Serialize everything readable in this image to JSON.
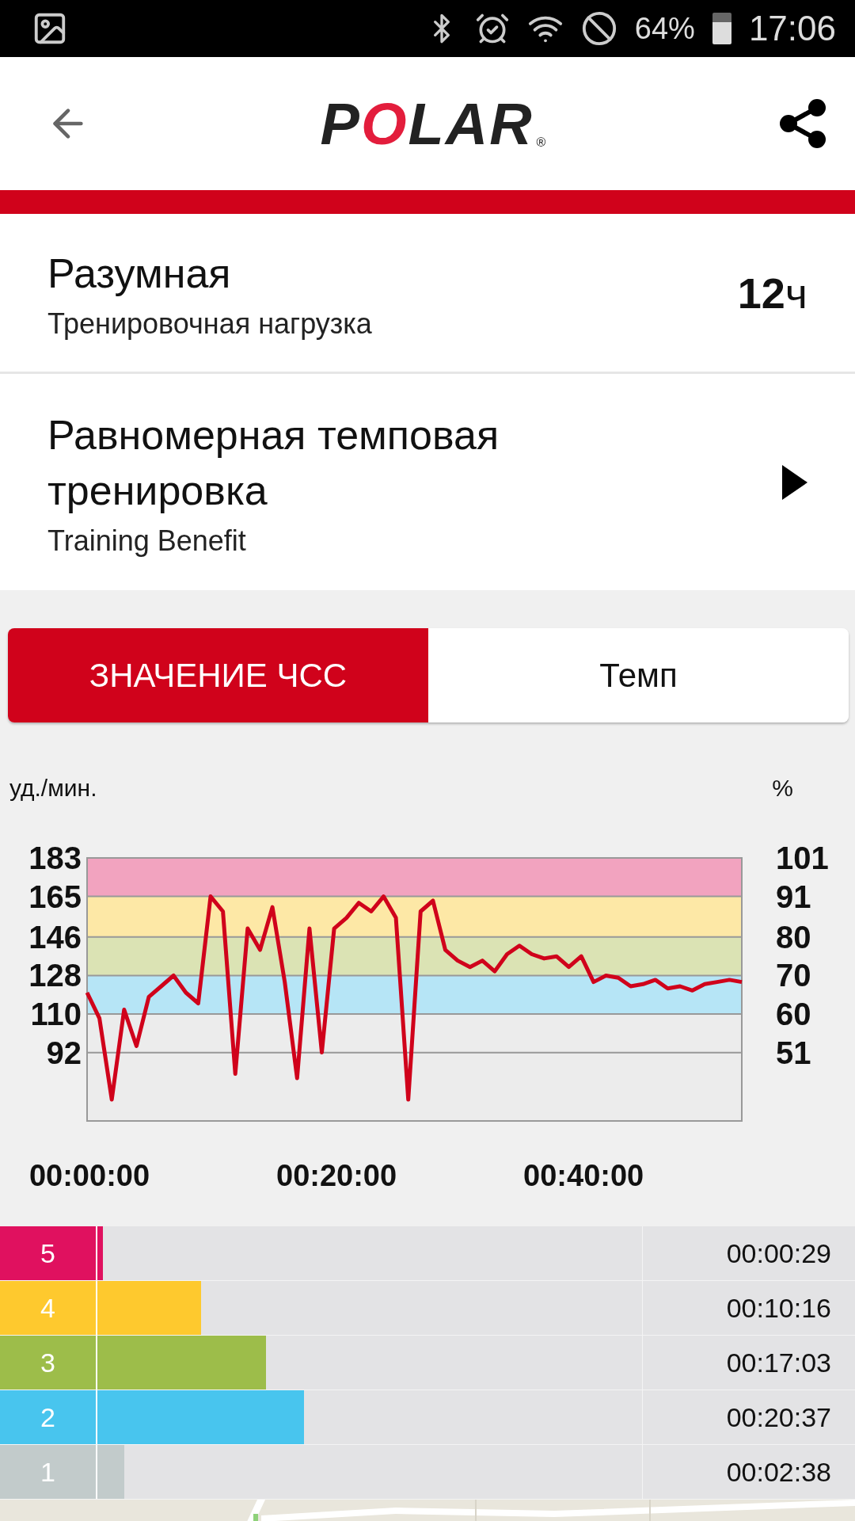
{
  "status_bar": {
    "battery": "64%",
    "time": "17:06"
  },
  "app_bar": {
    "logo": "POLAR",
    "logo_mark": "®"
  },
  "summary": {
    "title": "Разумная",
    "subtitle": "Тренировочная нагрузка",
    "value": "**12**ч"
  },
  "benefit": {
    "title": "Равномерная темповая тренировка",
    "subtitle": "Training Benefit"
  },
  "tabs": [
    {
      "label": "ЗНАЧЕНИЕ ЧСС",
      "selected": true
    },
    {
      "label": "Темп",
      "selected": false
    }
  ],
  "chart": {
    "right_unit": "%",
    "right_ticks": [
      "101",
      "91",
      "80",
      "70",
      "60",
      "51"
    ],
    "chart_data": {
      "type": "line",
      "ylabel": "уд./мин.",
      "xlim": [
        0,
        53
      ],
      "ylim": [
        60,
        183
      ],
      "grid": true,
      "bands": [
        {
          "axis": "y",
          "from": 165,
          "to": 183,
          "color": "#f2a3bf"
        },
        {
          "axis": "y",
          "from": 146,
          "to": 165,
          "color": "#fde8a6"
        },
        {
          "axis": "y",
          "from": 128,
          "to": 146,
          "color": "#dbe3b4"
        },
        {
          "axis": "y",
          "from": 110,
          "to": 128,
          "color": "#b6e5f6"
        }
      ],
      "yticks": [
        183,
        165,
        146,
        128,
        110,
        92
      ],
      "xticks": [
        {
          "value": 0,
          "label": "00:00:00"
        },
        {
          "value": 20,
          "label": "00:20:00"
        },
        {
          "value": 40,
          "label": "00:40:00"
        }
      ],
      "x": [
        0,
        1,
        2,
        3,
        4,
        5,
        6,
        7,
        8,
        9,
        10,
        11,
        12,
        13,
        14,
        15,
        16,
        17,
        18,
        19,
        20,
        21,
        22,
        23,
        24,
        25,
        26,
        27,
        28,
        29,
        30,
        31,
        32,
        33,
        34,
        35,
        36,
        37,
        38,
        39,
        40,
        41,
        42,
        43,
        44,
        45,
        46,
        47,
        48,
        49,
        50,
        51,
        52,
        53
      ],
      "series": [
        {
          "color": "#d0021b",
          "values": [
            120,
            108,
            70,
            112,
            95,
            118,
            123,
            128,
            120,
            115,
            165,
            158,
            82,
            150,
            140,
            160,
            125,
            80,
            150,
            92,
            150,
            155,
            162,
            158,
            165,
            155,
            70,
            158,
            163,
            140,
            135,
            132,
            135,
            130,
            138,
            142,
            138,
            136,
            137,
            132,
            137,
            125,
            128,
            127,
            123,
            124,
            126,
            122,
            123,
            121,
            124,
            125,
            126,
            125
          ]
        }
      ]
    }
  },
  "zones": [
    {
      "number": "5",
      "color": "#e0115f",
      "level": 0.01,
      "time": "00:00:29"
    },
    {
      "number": "4",
      "color": "#fec92e",
      "level": 0.19,
      "time": "00:10:16"
    },
    {
      "number": "3",
      "color": "#9dbd4a",
      "level": 0.31,
      "time": "00:17:03"
    },
    {
      "number": "2",
      "color": "#48c5ee",
      "level": 0.38,
      "time": "00:20:37"
    },
    {
      "number": "1",
      "color": "#c2cbcb",
      "level": 0.05,
      "time": "00:02:38"
    }
  ]
}
